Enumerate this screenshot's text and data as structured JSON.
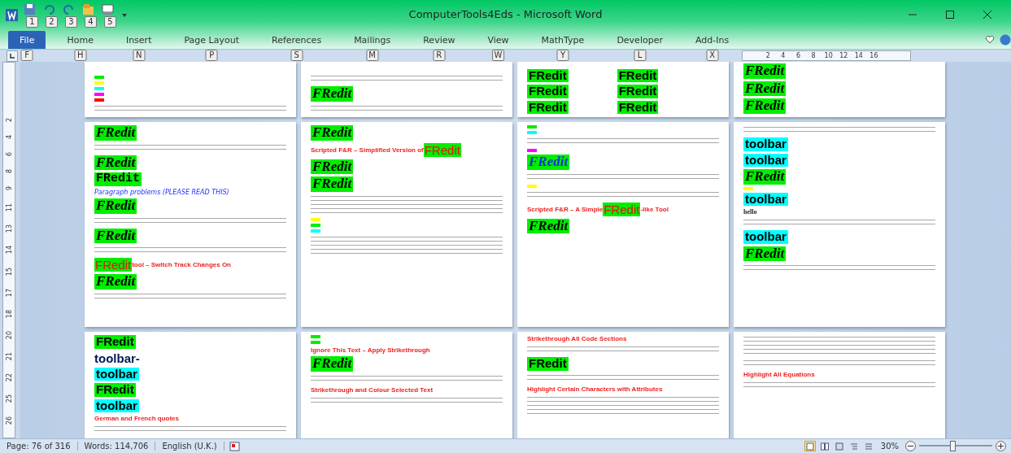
{
  "window": {
    "title": "ComputerTools4Eds  -  Microsoft Word",
    "quick_access_keytips": [
      "1",
      "2",
      "3",
      "4",
      "5"
    ]
  },
  "ribbon_tabs": [
    {
      "label": "File",
      "keytip": "F",
      "selected": true
    },
    {
      "label": "Home",
      "keytip": "H",
      "selected": false
    },
    {
      "label": "Insert",
      "keytip": "N",
      "selected": false
    },
    {
      "label": "Page Layout",
      "keytip": "P",
      "selected": false
    },
    {
      "label": "References",
      "keytip": "S",
      "selected": false
    },
    {
      "label": "Mailings",
      "keytip": "M",
      "selected": false
    },
    {
      "label": "Review",
      "keytip": "R",
      "selected": false
    },
    {
      "label": "View",
      "keytip": "W",
      "selected": false
    },
    {
      "label": "MathType",
      "keytip": "Y",
      "selected": false
    },
    {
      "label": "Developer",
      "keytip": "L",
      "selected": false
    },
    {
      "label": "Add-Ins",
      "keytip": "X",
      "selected": false
    }
  ],
  "ruler": {
    "ticks": [
      "2",
      "4",
      "6",
      "8",
      "10",
      "12",
      "14",
      "16"
    ]
  },
  "vertical_ruler": {
    "ticks": [
      "2",
      "4",
      "6",
      "8",
      "9",
      "11",
      "13",
      "14",
      "15",
      "17",
      "18",
      "20",
      "21",
      "22",
      "25",
      "26"
    ]
  },
  "pages": [
    {
      "items": [
        {
          "kind": "swatch",
          "color": "#00ee00"
        },
        {
          "kind": "swatch",
          "color": "#ffff00"
        },
        {
          "kind": "swatch",
          "color": "#00ffff"
        },
        {
          "kind": "swatch",
          "color": "#ff00ff"
        },
        {
          "kind": "swatch",
          "color": "#ff0000"
        },
        {
          "kind": "lines"
        }
      ]
    },
    {
      "items": [
        {
          "kind": "lines"
        },
        {
          "kind": "italic_word",
          "text": "FRedit",
          "color": "#00ee00"
        },
        {
          "kind": "lines"
        }
      ]
    },
    {
      "items": [
        {
          "kind": "pair",
          "texts": [
            "FRedit",
            "FRedit"
          ],
          "color": "#00ee00"
        },
        {
          "kind": "pair",
          "texts": [
            "FRedit",
            "FRedit"
          ],
          "color": "#00ee00"
        },
        {
          "kind": "pair",
          "texts": [
            "FRedit",
            "FRedit"
          ],
          "color": "#00ee00"
        }
      ]
    },
    {
      "items": [
        {
          "kind": "italic_word",
          "text": "FRedit",
          "color": "#00ee00"
        },
        {
          "kind": "italic_word",
          "text": "FRedit",
          "color": "#00ee00"
        },
        {
          "kind": "italic_word",
          "text": "FRedit",
          "color": "#00ee00"
        }
      ]
    },
    {
      "items": [
        {
          "kind": "italic_word",
          "text": "FRedit",
          "color": "#00ee00"
        },
        {
          "kind": "lines"
        },
        {
          "kind": "italic_word",
          "text": "FRedit",
          "color": "#00ee00"
        },
        {
          "kind": "mono_word",
          "text": "FRedit",
          "color": "#00ee00"
        },
        {
          "kind": "link",
          "text": "Paragraph problems (PLEASE READ THIS)"
        },
        {
          "kind": "italic_word",
          "text": "FRedit",
          "color": "#00ee00"
        },
        {
          "kind": "lines"
        },
        {
          "kind": "italic_word",
          "text": "FRedit",
          "color": "#00ee00"
        },
        {
          "kind": "lines"
        },
        {
          "kind": "badge_heading",
          "badge": "FRedit",
          "text": " tool – Switch Track Changes On"
        },
        {
          "kind": "italic_word",
          "text": "FRedit",
          "color": "#00ee00"
        },
        {
          "kind": "lines"
        }
      ]
    },
    {
      "items": [
        {
          "kind": "italic_word",
          "text": "FRedit",
          "color": "#00ee00"
        },
        {
          "kind": "heading_badge",
          "text": "Scripted F&R – Simplified Version of ",
          "badge": "FRedit"
        },
        {
          "kind": "italic_word",
          "text": "FRedit",
          "color": "#00ee00"
        },
        {
          "kind": "italic_word",
          "text": "FRedit",
          "color": "#00ee00"
        },
        {
          "kind": "long_lines"
        },
        {
          "kind": "swatch",
          "color": "#ffff00"
        },
        {
          "kind": "swatch",
          "color": "#00ee00"
        },
        {
          "kind": "swatch",
          "color": "#00ffff"
        },
        {
          "kind": "long_lines"
        }
      ]
    },
    {
      "items": [
        {
          "kind": "swatch",
          "color": "#00ee00"
        },
        {
          "kind": "swatch",
          "color": "#00ffff"
        },
        {
          "kind": "lines"
        },
        {
          "kind": "swatch",
          "color": "#ff00ff"
        },
        {
          "kind": "blue_word",
          "text": "FRedit",
          "color": "#00ee00"
        },
        {
          "kind": "lines"
        },
        {
          "kind": "swatch",
          "color": "#ffff00"
        },
        {
          "kind": "lines"
        },
        {
          "kind": "heading_badge",
          "text": "Scripted F&R – A Simple ",
          "badge": "FRedit",
          "after": "-like Tool"
        },
        {
          "kind": "italic_word",
          "text": "FRedit",
          "color": "#00ee00"
        }
      ]
    },
    {
      "items": [
        {
          "kind": "lines"
        },
        {
          "kind": "sans_word",
          "text": "toolbar",
          "color": "#00ffff"
        },
        {
          "kind": "sans_word",
          "text": "toolbar",
          "color": "#00ffff"
        },
        {
          "kind": "italic_word",
          "text": "FRedit",
          "color": "#00ee00"
        },
        {
          "kind": "swatch",
          "color": "#ffff00"
        },
        {
          "kind": "sans_word",
          "text": "toolbar",
          "color": "#00ffff"
        },
        {
          "kind": "bold",
          "text": "hello"
        },
        {
          "kind": "lines"
        },
        {
          "kind": "sans_word",
          "text": "toolbar",
          "color": "#00ffff"
        },
        {
          "kind": "italic_word",
          "text": "FRedit",
          "color": "#00ee00"
        },
        {
          "kind": "lines"
        }
      ]
    },
    {
      "items": [
        {
          "kind": "sans_word",
          "text": "FRedit",
          "color": "#00ee00"
        },
        {
          "kind": "plain",
          "text": "toolbar-"
        },
        {
          "kind": "sans_word",
          "text": "toolbar",
          "color": "#00ffff"
        },
        {
          "kind": "sans_word",
          "text": "FRedit",
          "color": "#00ee00"
        },
        {
          "kind": "sans_word",
          "text": "toolbar",
          "color": "#00ffff"
        },
        {
          "kind": "heading",
          "text": "German and French quotes"
        },
        {
          "kind": "lines"
        }
      ]
    },
    {
      "items": [
        {
          "kind": "swatch",
          "color": "#00ee00"
        },
        {
          "kind": "swatch",
          "color": "#00ee00"
        },
        {
          "kind": "heading",
          "text": "Ignore This Text – Apply Strikethrough"
        },
        {
          "kind": "italic_word",
          "text": "FRedit",
          "color": "#00ee00"
        },
        {
          "kind": "lines"
        },
        {
          "kind": "heading",
          "text": "Strikethrough and Colour Selected Text"
        },
        {
          "kind": "lines"
        }
      ]
    },
    {
      "items": [
        {
          "kind": "heading",
          "text": "Strikethrough All Code Sections"
        },
        {
          "kind": "lines"
        },
        {
          "kind": "sans_word",
          "text": "FRedit",
          "color": "#00ee00"
        },
        {
          "kind": "lines"
        },
        {
          "kind": "heading",
          "text": "Highlight Certain Characters with Attributes"
        },
        {
          "kind": "long_lines"
        }
      ]
    },
    {
      "items": [
        {
          "kind": "long_lines"
        },
        {
          "kind": "lines"
        },
        {
          "kind": "heading",
          "text": "Highlight All Equations"
        },
        {
          "kind": "lines"
        }
      ]
    }
  ],
  "status_bar": {
    "page": "Page: 76 of 316",
    "words": "Words: 114,706",
    "language": "English (U.K.)",
    "zoom": "30%",
    "zoom_slider": {
      "level": 0.45
    }
  }
}
